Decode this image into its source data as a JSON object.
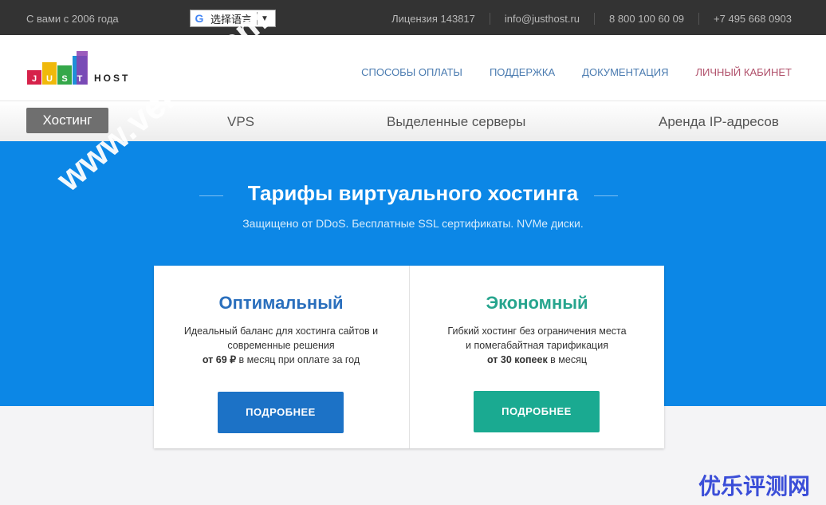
{
  "topbar": {
    "since": "С вами с 2006 года",
    "translate_label": "选择语言",
    "license": "Лицензия 143817",
    "email": "info@justhost.ru",
    "phone1": "8 800 100 60 09",
    "phone2": "+7 495 668 0903"
  },
  "logo": {
    "letters": [
      "J",
      "U",
      "S",
      "T"
    ],
    "word": "HOST",
    "colors": [
      "#d6224a",
      "#f0b90b",
      "#35a84a",
      "#1f8fd8",
      "#8a3fb0"
    ]
  },
  "nav": {
    "payment": "СПОСОБЫ ОПЛАТЫ",
    "support": "ПОДДЕРЖКА",
    "docs": "ДОКУМЕНТАЦИЯ",
    "cabinet": "ЛИЧНЫЙ КАБИНЕТ"
  },
  "tabs": {
    "hosting": "Хостинг",
    "vps": "VPS",
    "dedicated": "Выделенные серверы",
    "ip": "Аренда IP-адресов"
  },
  "hero": {
    "title": "Тарифы виртуального хостинга",
    "subtitle": "Защищено от DDoS. Бесплатные SSL сертификаты. NVMe диски."
  },
  "plans": [
    {
      "name": "Оптимальный",
      "desc1": "Идеальный баланс для хостинга сайтов и",
      "desc2": "современные решения",
      "price_bold": "от 69 ₽",
      "price_rest": " в месяц при оплате за год",
      "button": "ПОДРОБНЕЕ"
    },
    {
      "name": "Экономный",
      "desc1": "Гибкий хостинг без ограничения места",
      "desc2": "и помегабайтная тарификация",
      "price_bold": "от 30 копеек",
      "price_rest": " в месяц",
      "button": "ПОДРОБНЕЕ"
    }
  ],
  "watermarks": {
    "site": "www.veidc.com",
    "brand": "优乐评测网"
  }
}
